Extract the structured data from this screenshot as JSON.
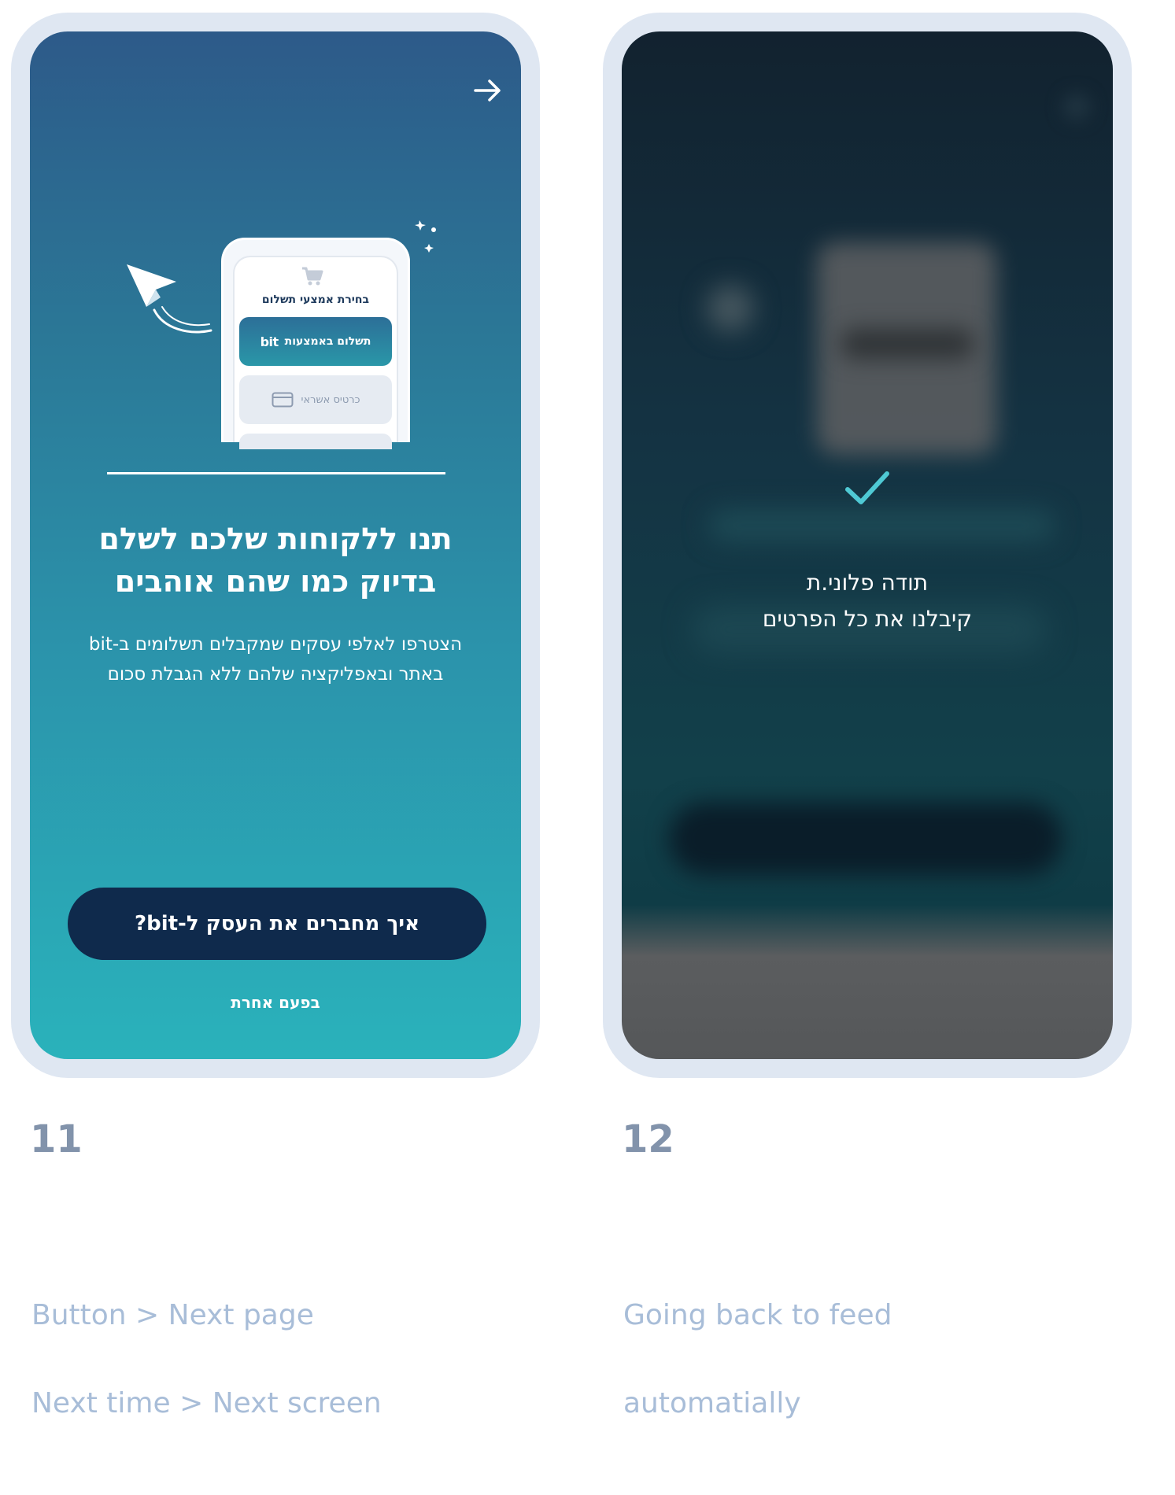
{
  "screen1": {
    "back_icon": "arrow-right-icon",
    "illustration": {
      "payment_title": "בחירת אמצעי תשלום",
      "bit_option": "תשלום באמצעות",
      "bit_logo": "bit",
      "card_option": "כרטיס אשראי"
    },
    "headline_line1": "תנו ללקוחות שלכם לשלם",
    "headline_line2": "בדיוק כמו שהם אוהבים",
    "sub_line1": "הצטרפו לאלפי עסקים שמקבלים תשלומים ב-bit",
    "sub_line2": "באתר ובאפליקציה שלהם ללא הגבלת סכום",
    "cta_label": "איך מחברים את העסק ל-bit?",
    "later_label": "בפעם אחרת"
  },
  "screen2": {
    "check_icon": "checkmark-icon",
    "thanks_line1": "תודה פלוני.ת",
    "thanks_line2": "קיבלנו את כל הפרטים"
  },
  "steps": [
    {
      "number": "11",
      "caption_line1": "Button > Next page",
      "caption_line2": "Next time > Next screen"
    },
    {
      "number": "12",
      "caption_line1": "Going back to feed",
      "caption_line2": "automatially"
    }
  ],
  "colors": {
    "frame": "#dfe7f2",
    "cta_bg": "#0f2a4c",
    "check": "#4fc9d4",
    "step_number": "#8293ab",
    "caption": "#a8bdd8"
  }
}
